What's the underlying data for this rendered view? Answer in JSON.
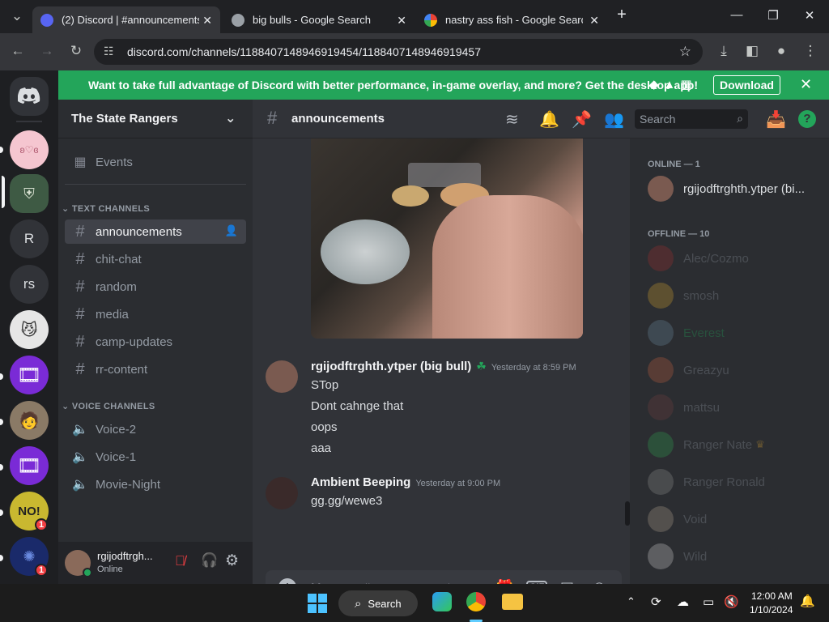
{
  "browser": {
    "tabs": [
      {
        "title": "(2) Discord | #announcements |",
        "fav_color": "#5865f2",
        "badge": "2"
      },
      {
        "title": "big bulls - Google Search",
        "fav_color": "#e8eaed"
      },
      {
        "title": "nastry ass fish - Google Search",
        "fav_color": "#e8eaed"
      }
    ],
    "new_tab": "+",
    "url": "discord.com/channels/1188407148946919454/1188407148946919457"
  },
  "banner": {
    "text": "Want to take full advantage of Discord with better performance, in-game overlay, and more? Get the desktop app!",
    "download": "Download"
  },
  "guilds": [
    {
      "letters": "",
      "color": "#f5c6d0"
    },
    {
      "letters": "",
      "color": "#3e5a44"
    },
    {
      "letters": "R",
      "color": "#313338"
    },
    {
      "letters": "rs",
      "color": "#313338"
    },
    {
      "letters": "",
      "color": "#d9d9d9"
    },
    {
      "letters": "",
      "color": "#7a2bd6"
    },
    {
      "letters": "",
      "color": "#7a6a5a"
    },
    {
      "letters": "",
      "color": "#7a2bd6"
    },
    {
      "letters": "",
      "color": "#c0c030",
      "badge": "1"
    },
    {
      "letters": "",
      "color": "#1a2a6a",
      "badge": "1"
    }
  ],
  "server": {
    "name": "The State Rangers",
    "events": "Events",
    "text_category": "TEXT CHANNELS",
    "text_channels": [
      "announcements",
      "chit-chat",
      "random",
      "media",
      "camp-updates",
      "rr-content"
    ],
    "voice_category": "VOICE CHANNELS",
    "voice_channels": [
      "Voice-2",
      "Voice-1",
      "Movie-Night"
    ]
  },
  "user": {
    "name": "rgijodftrgh...",
    "status": "Online"
  },
  "channel": {
    "name": "announcements",
    "search_placeholder": "Search"
  },
  "messages": [
    {
      "author": "rgijodftrghth.ytper (big bull)",
      "timestamp": "Yesterday at 8:59 PM",
      "lines": [
        "STop",
        "Dont cahnge that",
        "oops",
        "aaa"
      ]
    },
    {
      "author": "Ambient Beeping",
      "timestamp": "Yesterday at 9:00 PM",
      "lines": [
        "gg.gg/wewe3"
      ]
    }
  ],
  "composer": {
    "placeholder": "Message #announcements"
  },
  "members": {
    "online_header": "ONLINE — 1",
    "online": [
      {
        "name": "rgijodftrghth.ytper (bi..."
      }
    ],
    "offline_header": "OFFLINE — 10",
    "offline": [
      {
        "name": "Alec/Cozmo",
        "color": "#949ba4"
      },
      {
        "name": "smosh",
        "color": "#949ba4"
      },
      {
        "name": "Everest",
        "color": "#23a55a"
      },
      {
        "name": "Greazyu",
        "color": "#949ba4"
      },
      {
        "name": "mattsu",
        "color": "#949ba4"
      },
      {
        "name": "Ranger Nate",
        "color": "#949ba4"
      },
      {
        "name": "Ranger Ronald",
        "color": "#949ba4"
      },
      {
        "name": "Void",
        "color": "#949ba4"
      },
      {
        "name": "Wild",
        "color": "#949ba4"
      }
    ]
  },
  "taskbar": {
    "search": "Search",
    "time": "12:00 AM",
    "date": "1/10/2024"
  },
  "colors": {
    "accent": "#5865f2",
    "banner": "#23a55a",
    "online": "#23a55a",
    "mention": "#f23f43"
  }
}
